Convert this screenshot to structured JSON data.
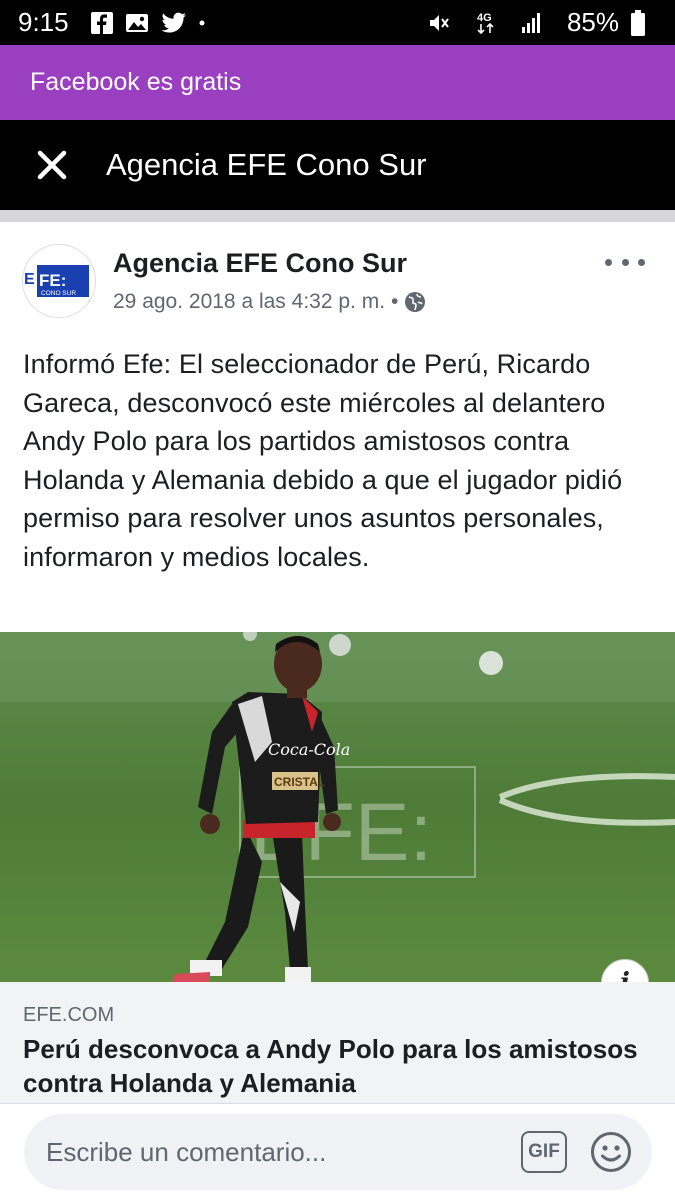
{
  "status_bar": {
    "time": "9:15",
    "icons": [
      "facebook-icon",
      "image-icon",
      "twitter-icon",
      "dot-icon"
    ],
    "right_icons": [
      "mute-icon",
      "4g-icon",
      "signal-icon",
      "battery-icon"
    ],
    "network": "4G",
    "battery": "85%"
  },
  "promo": {
    "text": "Facebook es gratis"
  },
  "header": {
    "title": "Agencia EFE Cono Sur",
    "close_icon": "close-icon"
  },
  "post": {
    "page_name": "Agencia EFE Cono Sur",
    "avatar_logo": "EFE CONO SUR",
    "timestamp": "29 ago. 2018 a las 4:32 p. m.",
    "separator": "•",
    "privacy_icon": "globe-icon",
    "text": "Informó Efe: El seleccionador de Perú, Ricardo Gareca, desconvocó este miércoles al delantero Andy Polo para los partidos amistosos contra Holanda y Alemania debido a que el jugador pidió permiso para resolver unos asuntos personales, informaron y medios locales."
  },
  "photo": {
    "jersey_sponsor": "Coca-Cola",
    "chest_text": "CRISTAL",
    "watermark": "EFE:"
  },
  "link_preview": {
    "domain": "EFE.COM",
    "title": "Perú desconvoca a Andy Polo para los amistosos contra Holanda y Alemania"
  },
  "composer": {
    "placeholder": "Escribe un comentario...",
    "gif_label": "GIF",
    "emoji_icon": "smiley-icon"
  },
  "colors": {
    "promo_bg": "#9b3fc1",
    "header_bg": "#000000",
    "efe_blue": "#1a3fb0",
    "grass": "#4f7a38"
  }
}
